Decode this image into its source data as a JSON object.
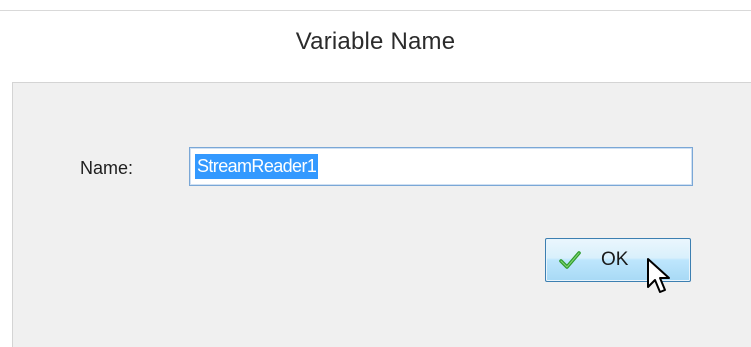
{
  "dialog": {
    "title": "Variable Name",
    "name_label": "Name:",
    "name_value": "StreamReader1",
    "ok_label": "OK"
  },
  "icons": {
    "check": "checkmark-icon",
    "cursor": "mouse-pointer-icon"
  },
  "colors": {
    "selection": "#3399ff",
    "check": "#2e9b2e",
    "button_border": "#3c7fb1"
  }
}
